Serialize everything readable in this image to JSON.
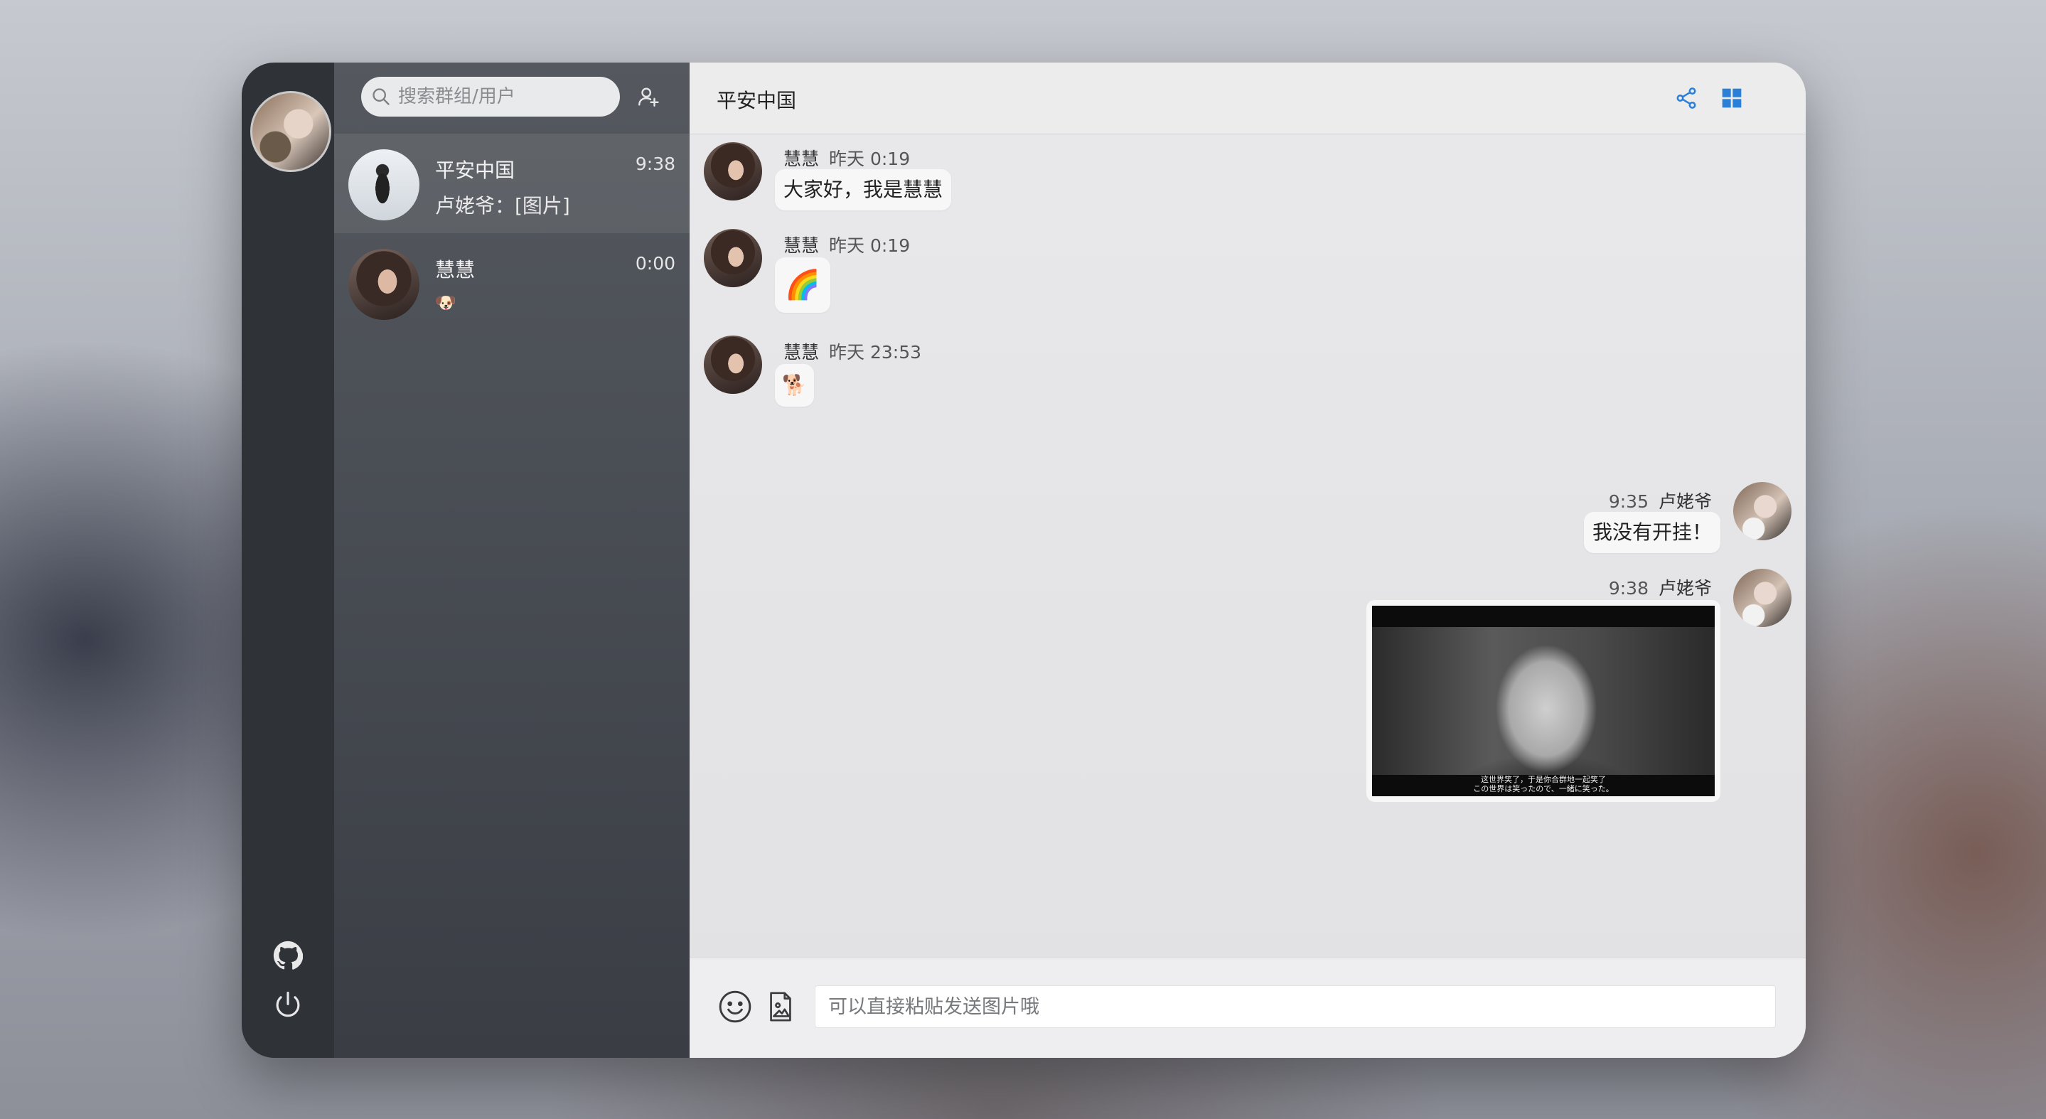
{
  "sidebar": {
    "github_icon": "github-icon",
    "logout_icon": "power-icon"
  },
  "search": {
    "placeholder": "搜索群组/用户",
    "add_icon": "add-user-icon"
  },
  "conversations": [
    {
      "name": "平安中国",
      "preview": "卢姥爷：[图片]",
      "time": "9:38",
      "active": true
    },
    {
      "name": "慧慧",
      "preview": "🐶",
      "time": "0:00",
      "active": false
    }
  ],
  "chat": {
    "title": "平安中国",
    "share_icon": "share-icon",
    "grid_icon": "grid-icon",
    "accent_color": "#2b7fd6"
  },
  "messages": [
    {
      "nick": "慧慧",
      "time": "昨天 0:19",
      "content": "大家好，我是慧慧",
      "side": "left"
    },
    {
      "nick": "慧慧",
      "time": "昨天 0:19",
      "content": "🌈",
      "side": "left"
    },
    {
      "nick": "慧慧",
      "time": "昨天 23:53",
      "content": "🐕",
      "side": "left"
    },
    {
      "nick": "卢姥爷",
      "time": "9:35",
      "content": "我没有开挂！",
      "side": "right"
    },
    {
      "nick": "卢姥爷",
      "time": "9:38",
      "content": "[图片]",
      "side": "right",
      "image_caption_1": "这世界笑了，于是你合群地一起笑了",
      "image_caption_2": "この世界は笑ったので、一緒に笑った。"
    }
  ],
  "composer": {
    "placeholder": "可以直接粘贴发送图片哦",
    "emoji_icon": "smiley-icon",
    "image_icon": "image-file-icon"
  }
}
